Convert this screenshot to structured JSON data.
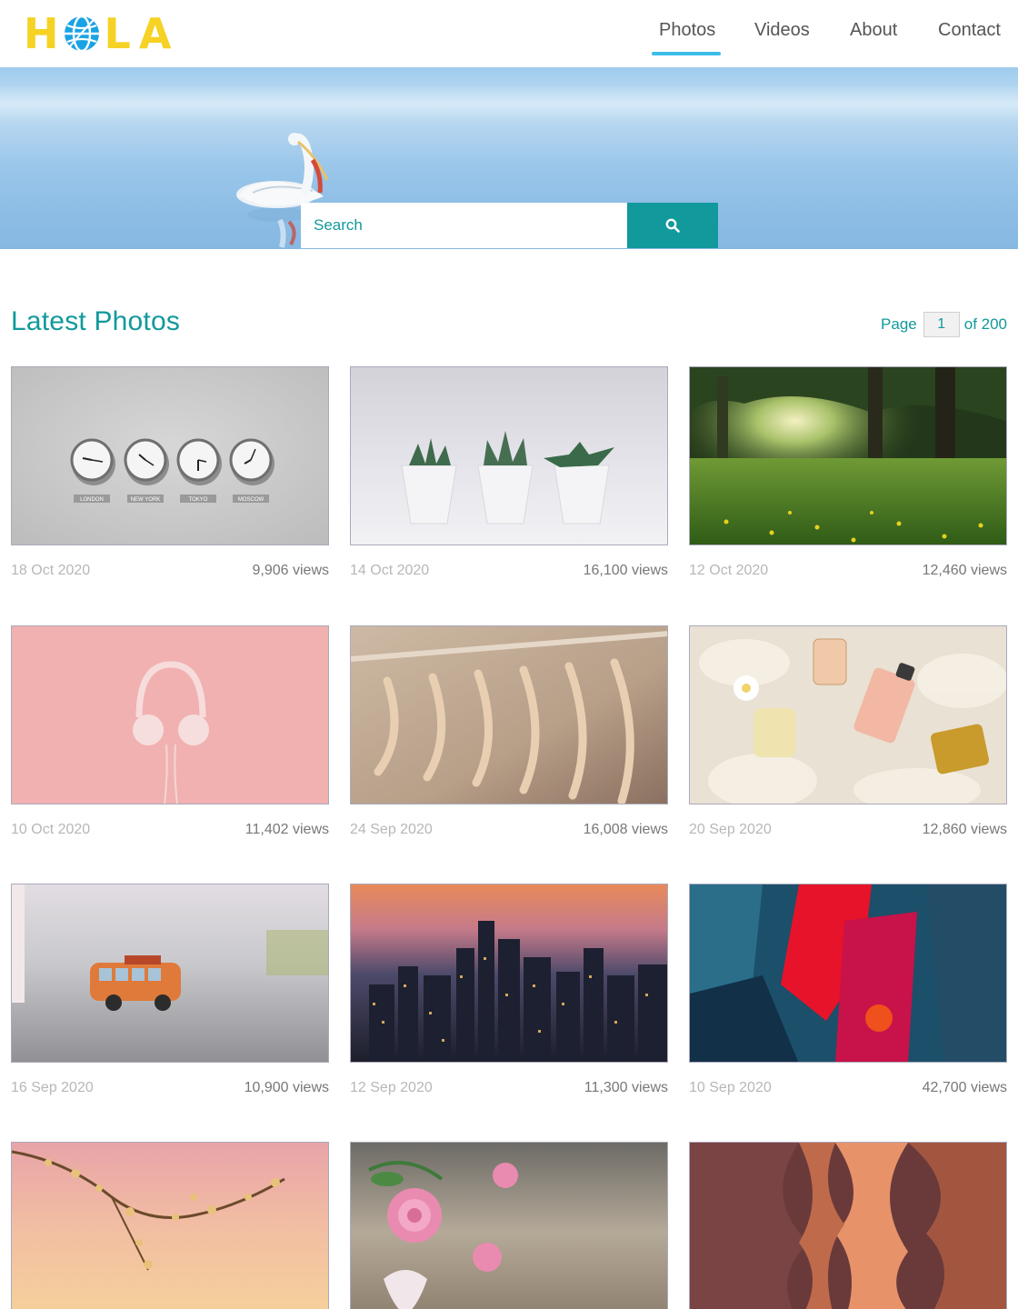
{
  "brand": {
    "logo_text": "HOLA",
    "accent_color": "#f5d224",
    "globe_color": "#1aa3e4"
  },
  "nav": {
    "items": [
      {
        "label": "Photos",
        "active": true
      },
      {
        "label": "Videos",
        "active": false
      },
      {
        "label": "About",
        "active": false
      },
      {
        "label": "Contact",
        "active": false
      }
    ]
  },
  "search": {
    "placeholder": "Search",
    "button_icon": "search-icon"
  },
  "section": {
    "title": "Latest Photos"
  },
  "pagination": {
    "prefix": "Page",
    "current": "1",
    "suffix": "of 200"
  },
  "photos": [
    {
      "subject": "world-clocks",
      "date": "18 Oct 2020",
      "views": "9,906 views",
      "labels": [
        "LONDON",
        "NEW YORK",
        "TOKYO",
        "MOSCOW"
      ]
    },
    {
      "subject": "succulents",
      "date": "14 Oct 2020",
      "views": "16,100 views"
    },
    {
      "subject": "forest-meadow",
      "date": "12 Oct 2020",
      "views": "12,460 views"
    },
    {
      "subject": "headphones",
      "date": "10 Oct 2020",
      "views": "11,402 views"
    },
    {
      "subject": "hangers",
      "date": "24 Sep 2020",
      "views": "16,008 views"
    },
    {
      "subject": "perfumes",
      "date": "20 Sep 2020",
      "views": "12,860 views"
    },
    {
      "subject": "toy-van",
      "date": "16 Sep 2020",
      "views": "10,900 views"
    },
    {
      "subject": "city-skyline",
      "date": "12 Sep 2020",
      "views": "11,300 views"
    },
    {
      "subject": "abstract-paint",
      "date": "10 Sep 2020",
      "views": "42,700 views"
    },
    {
      "subject": "blossom-branch",
      "date": "",
      "views": ""
    },
    {
      "subject": "roses",
      "date": "",
      "views": ""
    },
    {
      "subject": "canyon",
      "date": "",
      "views": ""
    }
  ],
  "colors": {
    "primary": "#12999b",
    "nav_underline": "#3bbde8",
    "muted": "#b7b7b7"
  }
}
